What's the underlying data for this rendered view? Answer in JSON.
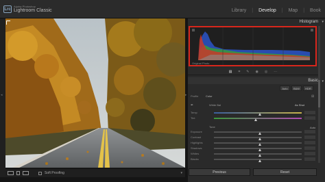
{
  "app": {
    "brand_top": "Adobe Photoshop",
    "brand_main": "Lightroom Classic",
    "logo": "Lrc"
  },
  "modules": [
    {
      "label": "Library",
      "active": false
    },
    {
      "label": "Develop",
      "active": true
    },
    {
      "label": "Map",
      "active": false
    },
    {
      "label": "Book",
      "active": false
    }
  ],
  "toolbar": {
    "soft_proofing_label": "Soft Proofing"
  },
  "histogram": {
    "title": "Histogram",
    "original_photo_label": "Original Photo",
    "highlight_color": "#d9261c"
  },
  "basic": {
    "title": "Basic",
    "treatment_buttons": [
      "Auto",
      "B&W",
      "HDR"
    ],
    "profile_label": "Profile",
    "profile_value": "Color",
    "wb_label": "White Bal",
    "wb_value": "As Shot",
    "wb_sliders": [
      {
        "label": "Temp",
        "value": 0.52
      },
      {
        "label": "Tint",
        "value": 0.48
      }
    ],
    "tone_label": "Tone",
    "tone_auto": "Auto",
    "tone_sliders": [
      {
        "label": "Exposure",
        "value": 0.52
      },
      {
        "label": "Contrast",
        "value": 0.52
      },
      {
        "label": "Highlights",
        "value": 0.52
      },
      {
        "label": "Shadows",
        "value": 0.52
      },
      {
        "label": "Whites",
        "value": 0.52
      },
      {
        "label": "Blacks",
        "value": 0.52
      }
    ]
  },
  "buttons": {
    "previous": "Previous",
    "reset": "Reset"
  }
}
